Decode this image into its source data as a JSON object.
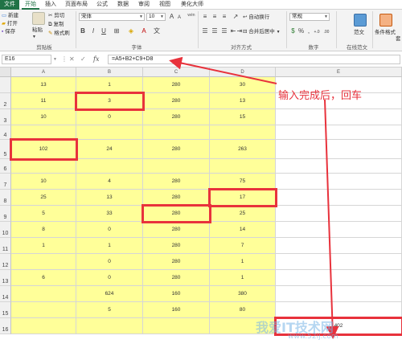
{
  "ribbon_tabs": [
    "文件",
    "开始",
    "插入",
    "页面布局",
    "公式",
    "数据",
    "审阅",
    "视图",
    "美化大师"
  ],
  "clipboard": {
    "new_label": "新建",
    "open_label": "打开",
    "save_label": "保存",
    "paste_label": "粘贴",
    "cut_label": "剪切",
    "copy_label": "复制",
    "format_painter_label": "格式刷",
    "group_label": "剪贴板"
  },
  "font": {
    "name": "宋体",
    "size": "10",
    "grow_label": "A",
    "shrink_label": "A",
    "bold_label": "B",
    "italic_label": "I",
    "underline_label": "U",
    "group_label": "字体",
    "wen_label": "wén"
  },
  "alignment": {
    "wrap_label": "自动换行",
    "merge_label": "合并后居中",
    "group_label": "对齐方式"
  },
  "number": {
    "format": "常规",
    "group_label": "数字",
    "currency_label": "$",
    "percent_label": "%",
    "comma_label": ",",
    "inc_decimal_label": "+.0",
    "dec_decimal_label": ".00"
  },
  "templates": {
    "label": "范文",
    "group_label": "在线范文"
  },
  "styles": {
    "conditional_label": "条件格式",
    "table_label": "套"
  },
  "formula_bar": {
    "name_box": "E16",
    "fx_label": "fx",
    "cancel_symbol": "✕",
    "enter_symbol": "✓",
    "formula": "=A5+B2+C9+D8"
  },
  "columns": [
    "A",
    "B",
    "C",
    "D",
    "E"
  ],
  "rows": [
    {
      "num": "",
      "cells": [
        "13",
        "1",
        "280",
        "30"
      ]
    },
    {
      "num": "2",
      "cells": [
        "11",
        "3",
        "280",
        "13"
      ]
    },
    {
      "num": "3",
      "cells": [
        "10",
        "0",
        "280",
        "15"
      ]
    },
    {
      "num": "4",
      "cells": [
        "",
        "",
        "",
        ""
      ]
    },
    {
      "num": "5",
      "cells": [
        "102",
        "24",
        "280",
        "263"
      ]
    },
    {
      "num": "6",
      "cells": [
        "",
        "",
        "",
        ""
      ]
    },
    {
      "num": "7",
      "cells": [
        "10",
        "4",
        "280",
        "75"
      ]
    },
    {
      "num": "8",
      "cells": [
        "25",
        "13",
        "280",
        "17"
      ]
    },
    {
      "num": "9",
      "cells": [
        "5",
        "33",
        "280",
        "25"
      ]
    },
    {
      "num": "10",
      "cells": [
        "8",
        "0",
        "280",
        "14"
      ]
    },
    {
      "num": "11",
      "cells": [
        "1",
        "1",
        "280",
        "7"
      ]
    },
    {
      "num": "12",
      "cells": [
        "",
        "0",
        "280",
        "1"
      ]
    },
    {
      "num": "13",
      "cells": [
        "6",
        "0",
        "280",
        "1"
      ]
    },
    {
      "num": "14",
      "cells": [
        "",
        "624",
        "160",
        "380"
      ]
    },
    {
      "num": "15",
      "cells": [
        "",
        "5",
        "160",
        "80"
      ]
    },
    {
      "num": "16",
      "cells": [
        "",
        "",
        "",
        ""
      ]
    }
  ],
  "result_cell": "402",
  "annotation": "输入完成后，回车",
  "watermark": "我爱IT技术网",
  "watermark_url": "www.52ij.com",
  "colors": {
    "accent": "#217346",
    "cell_fill": "#ffff99",
    "highlight": "#e8323c"
  }
}
